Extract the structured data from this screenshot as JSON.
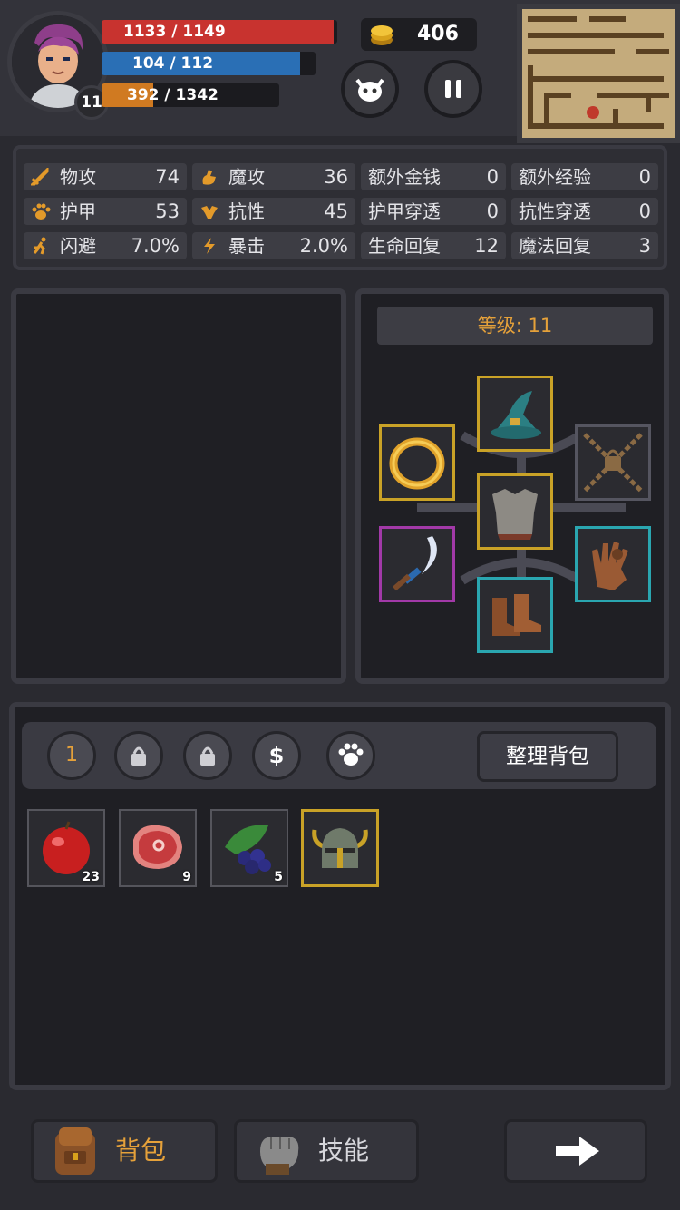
{
  "player": {
    "level": "11",
    "hp_text": "1133 / 1149",
    "hp_fraction": 0.986,
    "mp_text": "104 / 112",
    "mp_fraction": 0.929,
    "xp_text": "392 / 1342",
    "xp_fraction": 0.292
  },
  "currency": {
    "coins": "406"
  },
  "stats": {
    "phys_atk": {
      "label": "物攻",
      "value": "74"
    },
    "mag_atk": {
      "label": "魔攻",
      "value": "36"
    },
    "extra_gold": {
      "label": "额外金钱",
      "value": "0"
    },
    "extra_xp": {
      "label": "额外经验",
      "value": "0"
    },
    "armor": {
      "label": "护甲",
      "value": "53"
    },
    "resist": {
      "label": "抗性",
      "value": "45"
    },
    "armor_pen": {
      "label": "护甲穿透",
      "value": "0"
    },
    "resist_pen": {
      "label": "抗性穿透",
      "value": "0"
    },
    "dodge": {
      "label": "闪避",
      "value": "7.0%"
    },
    "crit": {
      "label": "暴击",
      "value": "2.0%"
    },
    "hp_regen": {
      "label": "生命回复",
      "value": "12"
    },
    "mp_regen": {
      "label": "魔法回复",
      "value": "3"
    }
  },
  "equipment": {
    "level_label": "等级: 11"
  },
  "bag": {
    "page_label": "1",
    "sort_label": "整理背包",
    "items": [
      {
        "name": "apple",
        "count": "23"
      },
      {
        "name": "meat",
        "count": "9"
      },
      {
        "name": "berries",
        "count": "5"
      },
      {
        "name": "horned-helmet",
        "count": ""
      }
    ]
  },
  "nav": {
    "bag_label": "背包",
    "skills_label": "技能"
  },
  "colors": {
    "hp": "#c8332f",
    "mp": "#2a6fb5",
    "xp": "#d07a21",
    "rarity_gold": "#c9a227",
    "rarity_purple": "#a239a8",
    "rarity_teal": "#2aa6b0"
  }
}
